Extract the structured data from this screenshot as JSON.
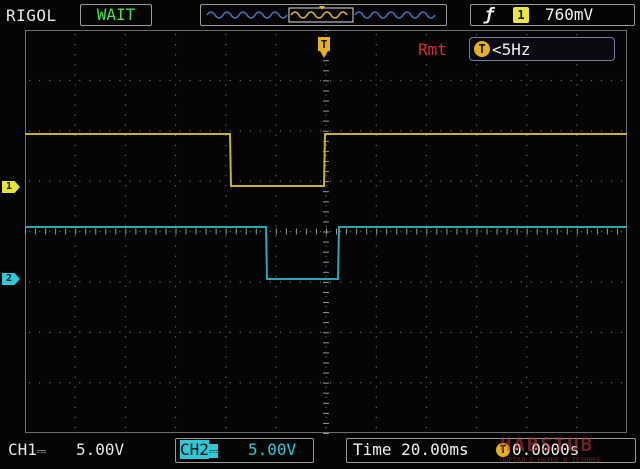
{
  "header": {
    "brand": "RIGOL",
    "status": "WAIT",
    "trigger_slope_icon": "rising-edge-icon",
    "trigger_channel": "1",
    "trigger_level": "760mV"
  },
  "screen": {
    "mode_label": "Rmt",
    "trigger_point_marker": "T",
    "freq_channel_icon": "T",
    "frequency": "<5Hz",
    "channels": [
      {
        "id": "1",
        "color": "#e6e63a"
      },
      {
        "id": "2",
        "color": "#2ec8d8"
      }
    ]
  },
  "footer": {
    "ch1_label": "CH1",
    "ch1_coupling_icon": "dc-coupling-icon",
    "ch1_scale": "5.00V",
    "ch2_label": "CH2",
    "ch2_coupling_icon": "dc-coupling-icon",
    "ch2_scale": "5.00V",
    "time_label": "Time 20.00ms",
    "offset_icon": "T",
    "time_offset": "0.0000s"
  },
  "watermark": {
    "text": "HABSTUB",
    "subtitle": "ПОРТАЛ О НАУКЕ И ТЕХНИКЕ"
  }
}
